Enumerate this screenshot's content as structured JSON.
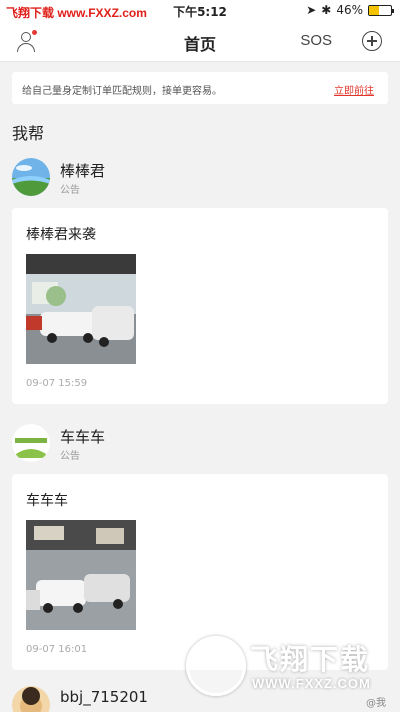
{
  "status_bar": {
    "watermark": "飞翔下载 www.FXXZ.com",
    "time": "下午5:12",
    "battery": "46%",
    "battery_level": 0.46
  },
  "nav": {
    "title": "首页",
    "sos": "SOS"
  },
  "notice": {
    "text": "给自己量身定制订单匹配规则，接单更容易。",
    "link": "立即前往"
  },
  "section": {
    "title": "我帮"
  },
  "posts": [
    {
      "author": "棒棒君",
      "role": "公告",
      "title": "棒棒君来袭",
      "time": "09-07 15:59"
    },
    {
      "author": "车车车",
      "role": "公告",
      "title": "车车车",
      "time": "09-07 16:01"
    }
  ],
  "third_author": {
    "name": "bbj_715201"
  },
  "watermark": {
    "brand": "飞翔下载",
    "url": "WWW.FXXZ.COM",
    "me": "@我"
  }
}
